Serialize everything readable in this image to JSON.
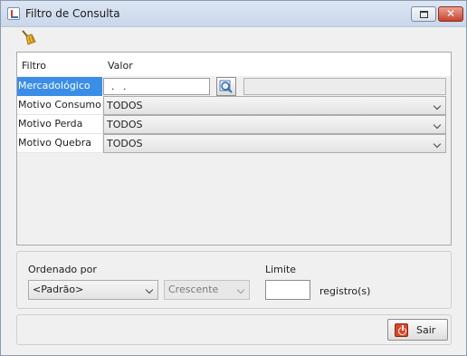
{
  "window": {
    "title": "Filtro de Consulta"
  },
  "toolbar": {
    "clear_icon": "broom-icon"
  },
  "grid": {
    "columns": [
      "Filtro",
      "Valor"
    ],
    "rows": [
      {
        "label": "Mercadológico",
        "value": ". .",
        "selected": true
      },
      {
        "label": "Motivo Consumo",
        "value": "TODOS"
      },
      {
        "label": "Motivo Perda",
        "value": "TODOS"
      },
      {
        "label": "Motivo Quebra",
        "value": "TODOS"
      }
    ]
  },
  "ordering": {
    "label": "Ordenado por",
    "sort_value": "<Padrão>",
    "direction_value": "Crescente"
  },
  "limit": {
    "label": "Limite",
    "value": "",
    "unit": "registro(s)"
  },
  "footer": {
    "exit_label": "Sair"
  },
  "colors": {
    "selection": "#3a8ee6",
    "close_button": "#c7432c",
    "exit_icon": "#d9472b"
  }
}
